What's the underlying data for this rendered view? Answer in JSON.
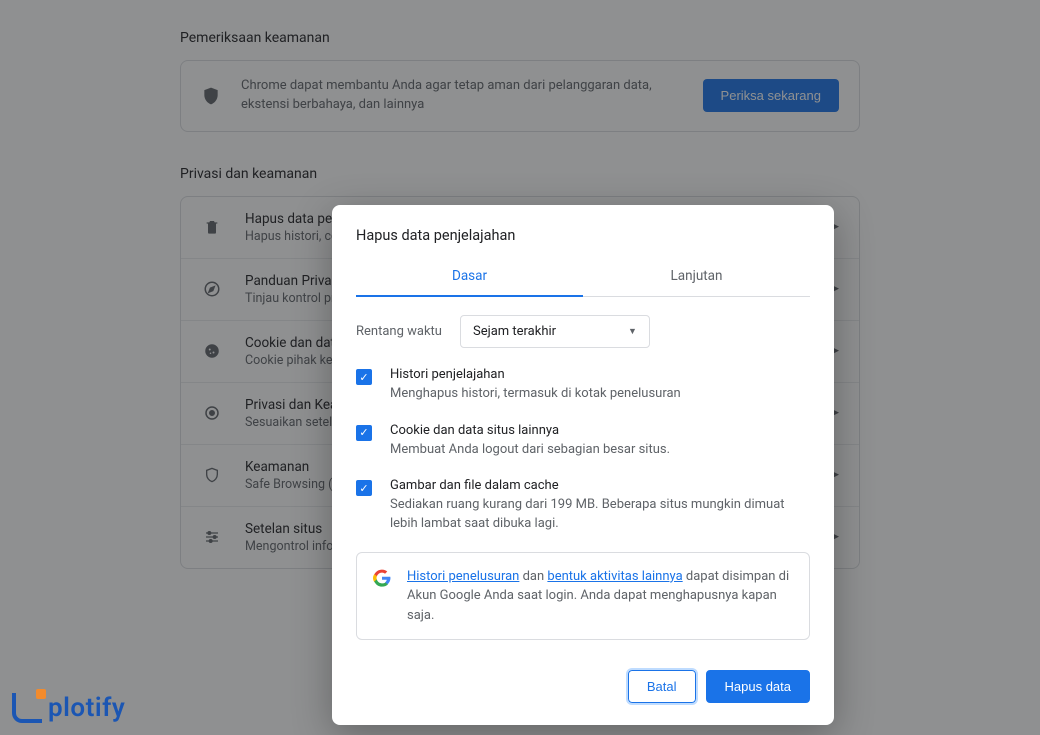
{
  "sections": {
    "safety_title": "Pemeriksaan keamanan",
    "privacy_title": "Privasi dan keamanan"
  },
  "safety_card": {
    "desc": "Chrome dapat membantu Anda agar tetap aman dari pelanggaran data, ekstensi berbahaya, dan lainnya",
    "button": "Periksa sekarang"
  },
  "rows": [
    {
      "title": "Hapus data penjelajahan",
      "sub": "Hapus histori, cookie, cache, dan lainnya"
    },
    {
      "title": "Panduan Privasi",
      "sub": "Tinjau kontrol privasi dan keamanan utama"
    },
    {
      "title": "Cookie dan data situs lainnya",
      "sub": "Cookie pihak ketiga diblokir di mode Samaran"
    },
    {
      "title": "Privasi dan Keamanan",
      "sub": "Sesuaikan setelan privasi"
    },
    {
      "title": "Keamanan",
      "sub": "Safe Browsing (perlindungan dari situs berbahaya) dan setelan keamanan lainnya"
    },
    {
      "title": "Setelan situs",
      "sub": "Mengontrol informasi yang dapat digunakan dan ditampilkan situs (lokasi, kamera, pop-up, dan lainnya)"
    }
  ],
  "dialog": {
    "title": "Hapus data penjelajahan",
    "tab_basic": "Dasar",
    "tab_advanced": "Lanjutan",
    "time_label": "Rentang waktu",
    "time_value": "Sejam terakhir",
    "items": [
      {
        "title": "Histori penjelajahan",
        "sub": "Menghapus histori, termasuk di kotak penelusuran"
      },
      {
        "title": "Cookie dan data situs lainnya",
        "sub": "Membuat Anda logout dari sebagian besar situs."
      },
      {
        "title": "Gambar dan file dalam cache",
        "sub": "Sediakan ruang kurang dari 199 MB. Beberapa situs mungkin dimuat lebih lambat saat dibuka lagi."
      }
    ],
    "info_link1": "Histori penelusuran",
    "info_mid1": " dan ",
    "info_link2": "bentuk aktivitas lainnya",
    "info_rest": " dapat disimpan di Akun Google Anda saat login. Anda dapat menghapusnya kapan saja.",
    "cancel": "Batal",
    "confirm": "Hapus data"
  },
  "watermark": "plotify"
}
